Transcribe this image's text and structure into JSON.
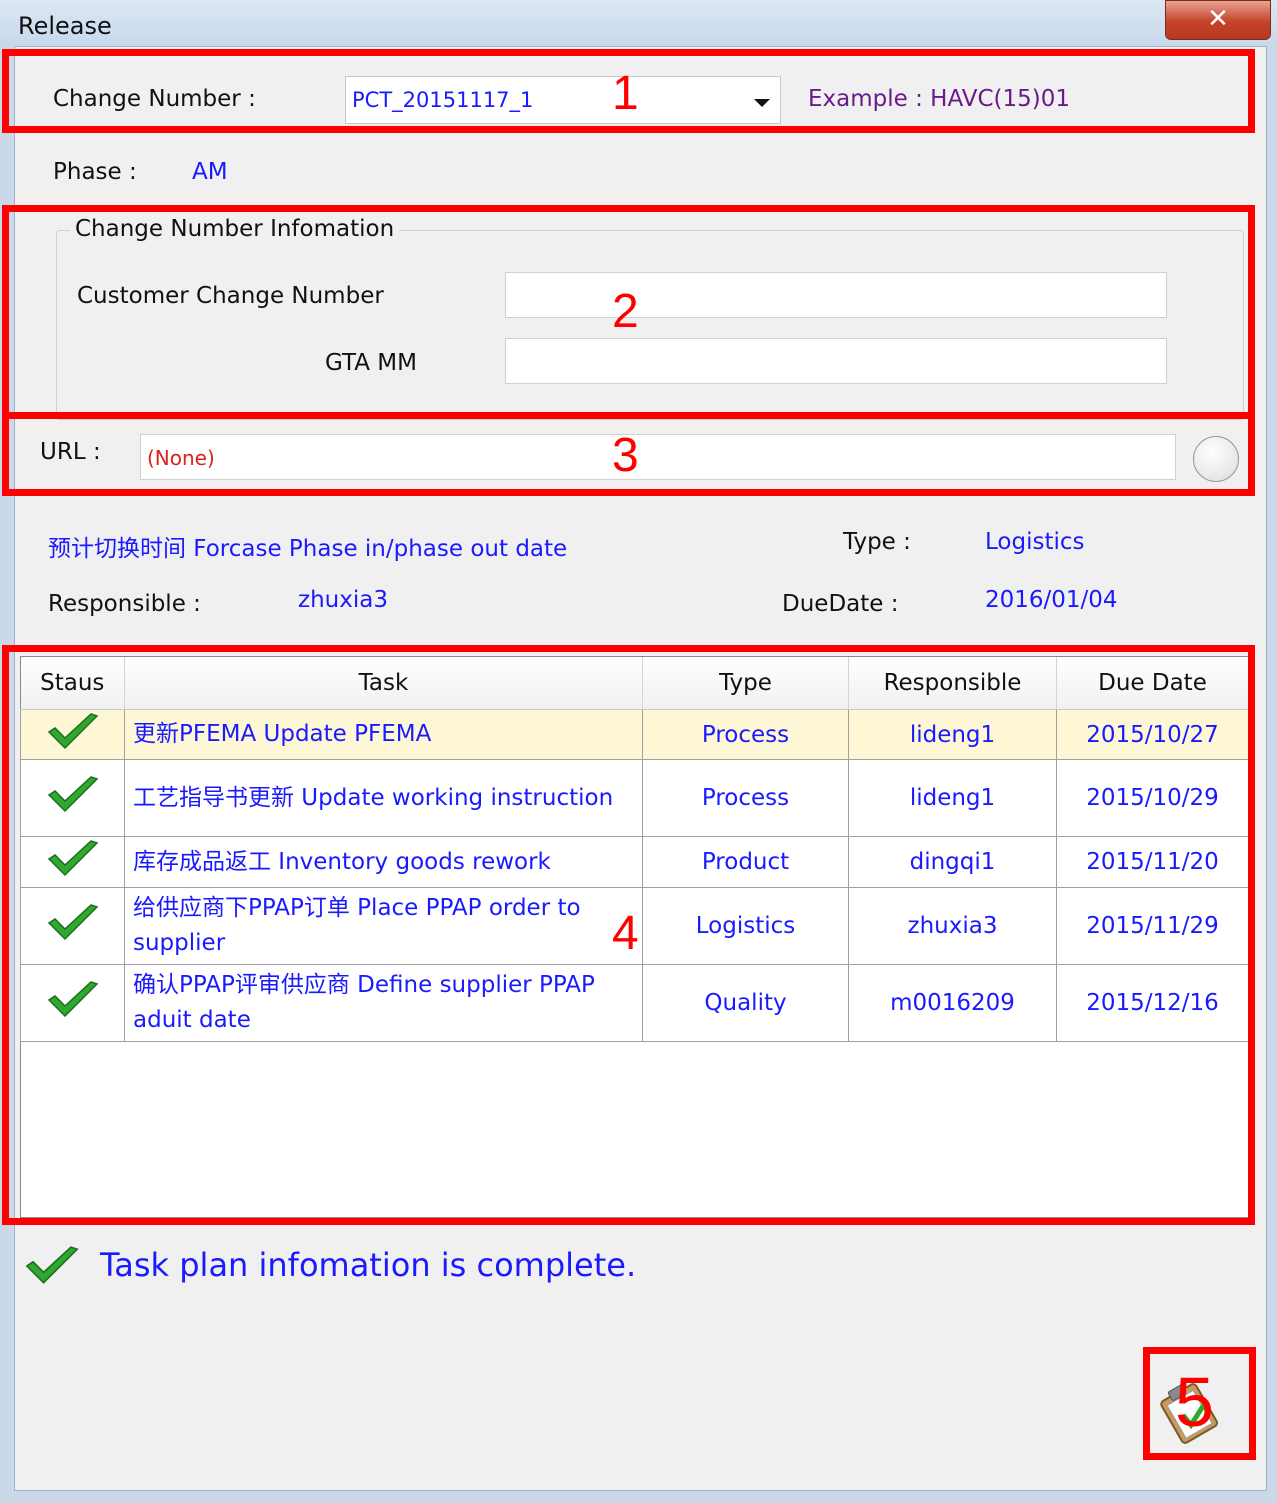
{
  "window": {
    "title": "Release",
    "close_glyph": "✕"
  },
  "change": {
    "label": "Change Number :",
    "value": "PCT_20151117_1",
    "example": "Example : HAVC(15)01"
  },
  "phase": {
    "label": "Phase :",
    "value": "AM"
  },
  "info_group": {
    "title": "Change Number Infomation",
    "customer_label": "Customer Change Number",
    "customer_value": "",
    "gta_label": "GTA MM",
    "gta_value": ""
  },
  "url": {
    "label": "URL :",
    "value": "(None)"
  },
  "details": {
    "forecast_label": "预计切换时间 Forcase Phase in/phase out date",
    "type_label": "Type :",
    "type_value": "Logistics",
    "responsible_label": "Responsible :",
    "responsible_value": "zhuxia3",
    "duedate_label": "DueDate :",
    "duedate_value": "2016/01/04"
  },
  "table": {
    "headers": [
      "Staus",
      "Task",
      "Type",
      "Responsible",
      "Due Date"
    ],
    "rows": [
      {
        "status": "check-icon",
        "task": "更新PFEMA Update PFEMA",
        "type": "Process",
        "responsible": "lideng1",
        "due": "2015/10/27"
      },
      {
        "status": "check-icon",
        "task": "工艺指导书更新  Update working instruction",
        "type": "Process",
        "responsible": "lideng1",
        "due": "2015/10/29"
      },
      {
        "status": "check-icon",
        "task": "库存成品返工 Inventory goods rework",
        "type": "Product",
        "responsible": "dingqi1",
        "due": "2015/11/20"
      },
      {
        "status": "check-icon",
        "task": "给供应商下PPAP订单 Place PPAP order to supplier",
        "type": "Logistics",
        "responsible": "zhuxia3",
        "due": "2015/11/29"
      },
      {
        "status": "check-icon",
        "task": "确认PPAP评审供应商 Define supplier PPAP aduit date",
        "type": "Quality",
        "responsible": "m0016209",
        "due": "2015/12/16"
      }
    ]
  },
  "status_message": "Task plan infomation is complete.",
  "annotations": [
    "1",
    "2",
    "3",
    "4",
    "5"
  ],
  "colors": {
    "accent": "#1a1aff",
    "annotation": "#ff0000",
    "url_none": "#e0201a"
  }
}
